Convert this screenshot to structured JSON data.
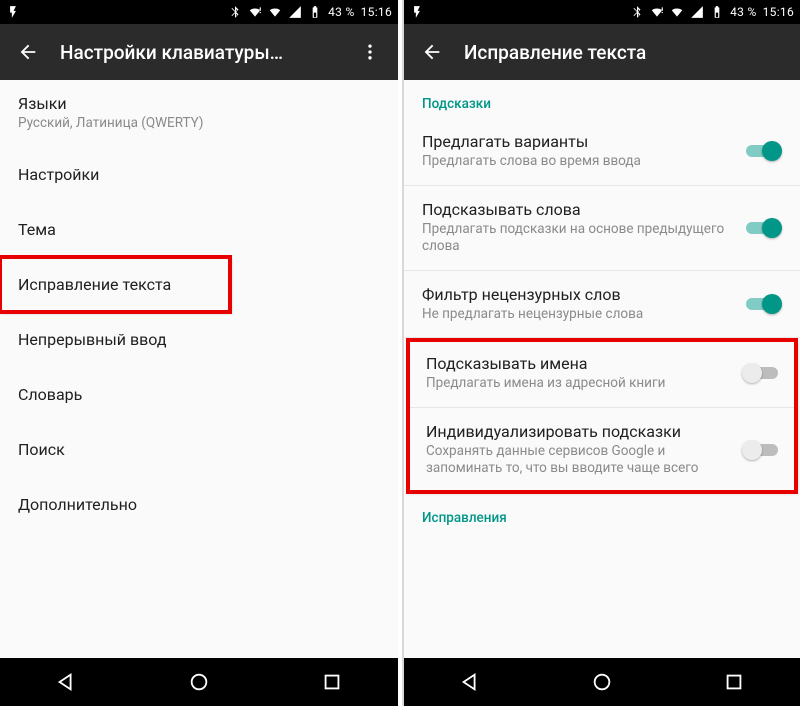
{
  "status": {
    "battery_text": "43 %",
    "time": "15:16"
  },
  "left": {
    "title": "Настройки клавиатуры…",
    "items": [
      {
        "title": "Языки",
        "sub": "Русский, Латиница (QWERTY)"
      },
      {
        "title": "Настройки"
      },
      {
        "title": "Тема"
      },
      {
        "title": "Исправление текста",
        "highlight": true
      },
      {
        "title": "Непрерывный ввод"
      },
      {
        "title": "Словарь"
      },
      {
        "title": "Поиск"
      },
      {
        "title": "Дополнительно"
      }
    ]
  },
  "right": {
    "title": "Исправление текста",
    "section1": "Подсказки",
    "section2": "Исправления",
    "items": [
      {
        "title": "Предлагать варианты",
        "sub": "Предлагать слова во время ввода",
        "on": true
      },
      {
        "title": "Подсказывать слова",
        "sub": "Предлагать подсказки на основе предыдущего слова",
        "on": true
      },
      {
        "title": "Фильтр нецензурных слов",
        "sub": "Не предлагать нецензурные слова",
        "on": true
      },
      {
        "title": "Подсказывать имена",
        "sub": "Предлагать имена из адресной книги",
        "on": false
      },
      {
        "title": "Индивидуализировать подсказки",
        "sub": "Сохранять данные сервисов Google и запоминать то, что вы вводите чаще всего",
        "on": false
      }
    ]
  }
}
